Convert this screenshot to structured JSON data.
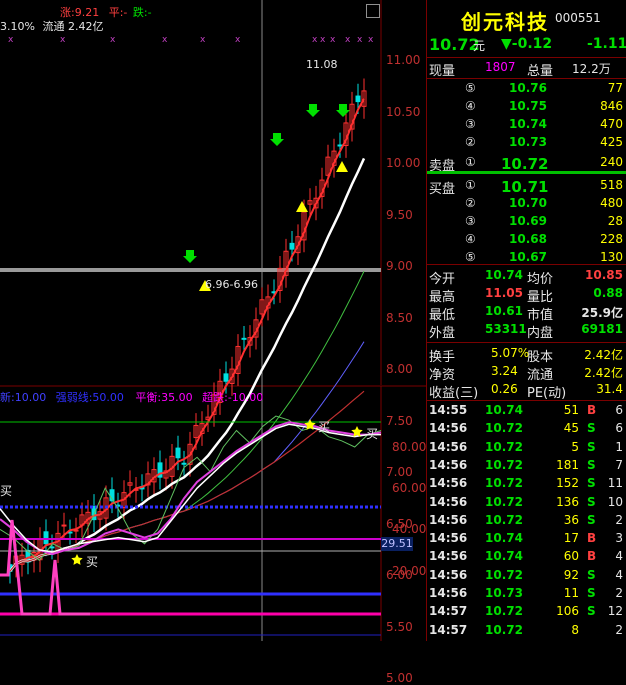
{
  "colors": {
    "up": "#ff4040",
    "down": "#00e000",
    "neutral": "#e6e6e6",
    "accent": "#ffff00",
    "magenta": "#ff00ff",
    "grid": "#7a0000"
  },
  "top_chart": {
    "header_line1": {
      "up": "涨:9.21",
      "flat": "平:-",
      "down": "跌:-"
    },
    "header_line2": {
      "ratio": "3.10%",
      "float_label": "流通",
      "float_value": "2.42亿"
    },
    "y_ticks": [
      "11.00",
      "10.50",
      "10.00",
      "9.50",
      "9.00",
      "8.50",
      "8.00",
      "7.50",
      "7.00",
      "6.50",
      "6.00",
      "5.50",
      "5.00"
    ],
    "high_label": "11.08",
    "low_label": "6.96-6.96",
    "window_icon": "window-icon"
  },
  "indicator": {
    "legend_a": "10.00",
    "legend_b_label": "强弱线:50.00",
    "legend_c_label": "平衡:35.00",
    "legend_d_label": "超跌:-10.00",
    "y_ticks": [
      "80.00",
      "60.00",
      "40.00",
      "20.00"
    ],
    "cursor_value": "29.51",
    "buy_label": "买",
    "buy_label_left": "买"
  },
  "stock": {
    "name": "创元科技",
    "code": "000551",
    "price": "10.72",
    "price_unit": "元",
    "change": "▼-0.12",
    "change_pct": "-1.11"
  },
  "volume": {
    "label_now": "现量",
    "now": "1807",
    "label_total": "总量",
    "total": "12.2万"
  },
  "sell_book": [
    {
      "level": "⑤",
      "price": "10.76",
      "vol": "77"
    },
    {
      "level": "④",
      "price": "10.75",
      "vol": "846"
    },
    {
      "level": "③",
      "price": "10.74",
      "vol": "470"
    },
    {
      "level": "②",
      "price": "10.73",
      "vol": "425"
    },
    {
      "level": "①",
      "price": "10.72",
      "vol": "240",
      "label": "卖盘"
    }
  ],
  "buy_book": [
    {
      "level": "①",
      "price": "10.71",
      "vol": "518",
      "label": "买盘"
    },
    {
      "level": "②",
      "price": "10.70",
      "vol": "480"
    },
    {
      "level": "③",
      "price": "10.69",
      "vol": "28"
    },
    {
      "level": "④",
      "price": "10.68",
      "vol": "228"
    },
    {
      "level": "⑤",
      "price": "10.67",
      "vol": "130"
    }
  ],
  "stats": [
    {
      "l1": "今开",
      "v1": "10.74",
      "l2": "均价",
      "v2": "10.85"
    },
    {
      "l1": "最高",
      "v1": "11.05",
      "l2": "量比",
      "v2": "0.88"
    },
    {
      "l1": "最低",
      "v1": "10.61",
      "l2": "市值",
      "v2": "25.9亿"
    },
    {
      "l1": "外盘",
      "v1": "53311",
      "l2": "内盘",
      "v2": "69181"
    }
  ],
  "stats2": [
    {
      "l1": "换手",
      "v1": "5.07%",
      "l2": "股本",
      "v2": "2.42亿"
    },
    {
      "l1": "净资",
      "v1": "3.24",
      "l2": "流通",
      "v2": "2.42亿"
    },
    {
      "l1": "收益(三)",
      "v1": "0.26",
      "l2": "PE(动)",
      "v2": "31.4"
    }
  ],
  "ticks": [
    {
      "t": "14:55",
      "p": "10.74",
      "v": "51",
      "s": "B",
      "n": "6"
    },
    {
      "t": "14:56",
      "p": "10.72",
      "v": "45",
      "s": "S",
      "n": "6"
    },
    {
      "t": "14:56",
      "p": "10.72",
      "v": "5",
      "s": "S",
      "n": "1"
    },
    {
      "t": "14:56",
      "p": "10.72",
      "v": "181",
      "s": "S",
      "n": "7"
    },
    {
      "t": "14:56",
      "p": "10.72",
      "v": "152",
      "s": "S",
      "n": "11"
    },
    {
      "t": "14:56",
      "p": "10.72",
      "v": "136",
      "s": "S",
      "n": "10"
    },
    {
      "t": "14:56",
      "p": "10.72",
      "v": "36",
      "s": "S",
      "n": "2"
    },
    {
      "t": "14:56",
      "p": "10.74",
      "v": "17",
      "s": "B",
      "n": "3"
    },
    {
      "t": "14:56",
      "p": "10.74",
      "v": "60",
      "s": "B",
      "n": "4"
    },
    {
      "t": "14:56",
      "p": "10.72",
      "v": "92",
      "s": "S",
      "n": "4"
    },
    {
      "t": "14:56",
      "p": "10.73",
      "v": "11",
      "s": "S",
      "n": "2"
    },
    {
      "t": "14:57",
      "p": "10.72",
      "v": "106",
      "s": "S",
      "n": "12"
    },
    {
      "t": "14:57",
      "p": "10.72",
      "v": "8",
      "s": "",
      "n": "2"
    }
  ]
}
